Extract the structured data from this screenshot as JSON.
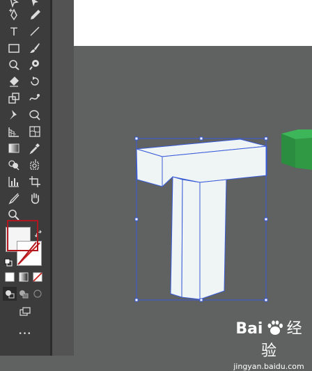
{
  "toolbar": {
    "type_tool_glyph": "T",
    "more_tools_glyph": "•••"
  },
  "swatches": {
    "fill_color": "#f5f5f5",
    "stroke_color": "#ffffff",
    "none_color": "#cc2222"
  },
  "canvas": {
    "artboard_color": "#ffffff",
    "background_color": "#5f6261",
    "object_face_color": "#eef5f4",
    "object_stroke_color": "#3a5bd9",
    "green_object_color": "#2f9a43"
  },
  "watermark": {
    "brand": "Bai",
    "brand_suffix": "经验",
    "url": "jingyan.baidu.com"
  }
}
